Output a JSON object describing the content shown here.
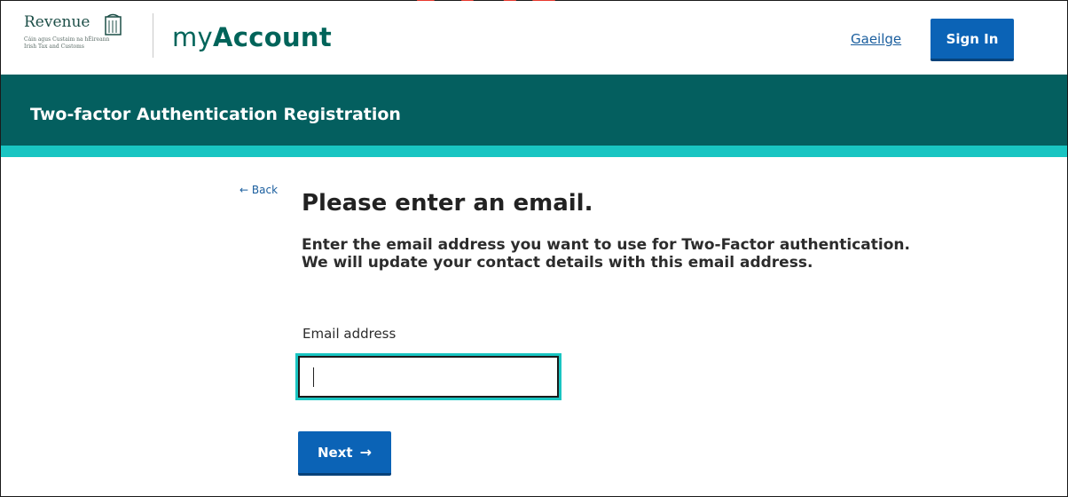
{
  "header": {
    "logo": {
      "name": "Revenue",
      "subtitle_line1": "Cáin agus Custaim na hÉireann",
      "subtitle_line2": "Irish Tax and Customs"
    },
    "brand": {
      "prefix": "my",
      "suffix": "Account"
    },
    "language_link": "Gaeilge",
    "sign_in_label": "Sign In",
    "accent_color": "#0b63b6"
  },
  "banner": {
    "title": "Two-factor Authentication Registration",
    "background_color": "#045f5f",
    "stripe_color": "#19c5c2"
  },
  "main": {
    "back_label": "Back",
    "heading": "Please enter an email.",
    "intro": "Enter the email address you want to use for Two-Factor authentication. We will update your contact details with this email address.",
    "email_field": {
      "label": "Email address",
      "value": ""
    },
    "next_label": "Next"
  },
  "icons": {
    "back": "arrow-left-icon",
    "next": "arrow-right-icon",
    "logo": "harp-icon"
  }
}
